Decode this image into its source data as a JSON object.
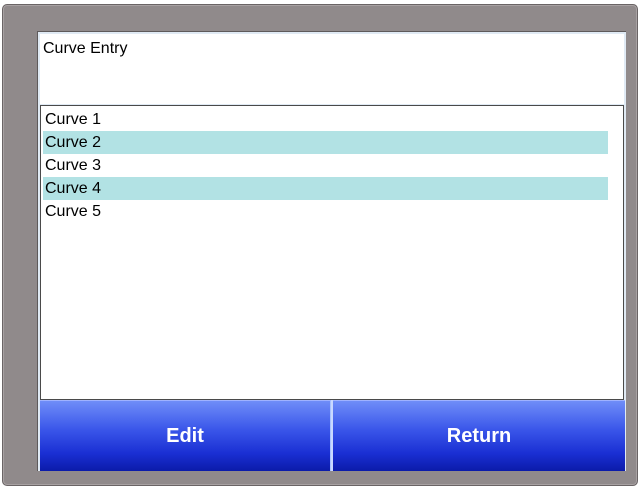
{
  "header": {
    "title": "Curve Entry"
  },
  "curves": {
    "items": [
      {
        "label": "Curve 1",
        "highlighted": false
      },
      {
        "label": "Curve 2",
        "highlighted": true
      },
      {
        "label": "Curve 3",
        "highlighted": false
      },
      {
        "label": "Curve 4",
        "highlighted": true
      },
      {
        "label": "Curve 5",
        "highlighted": false
      }
    ],
    "highlight_color": "#b2e2e4"
  },
  "buttons": {
    "edit_label": "Edit",
    "return_label": "Return",
    "button_color": "#2b45e0"
  },
  "colors": {
    "bezel": "#908a8b",
    "panel_background": "#ffffff"
  }
}
